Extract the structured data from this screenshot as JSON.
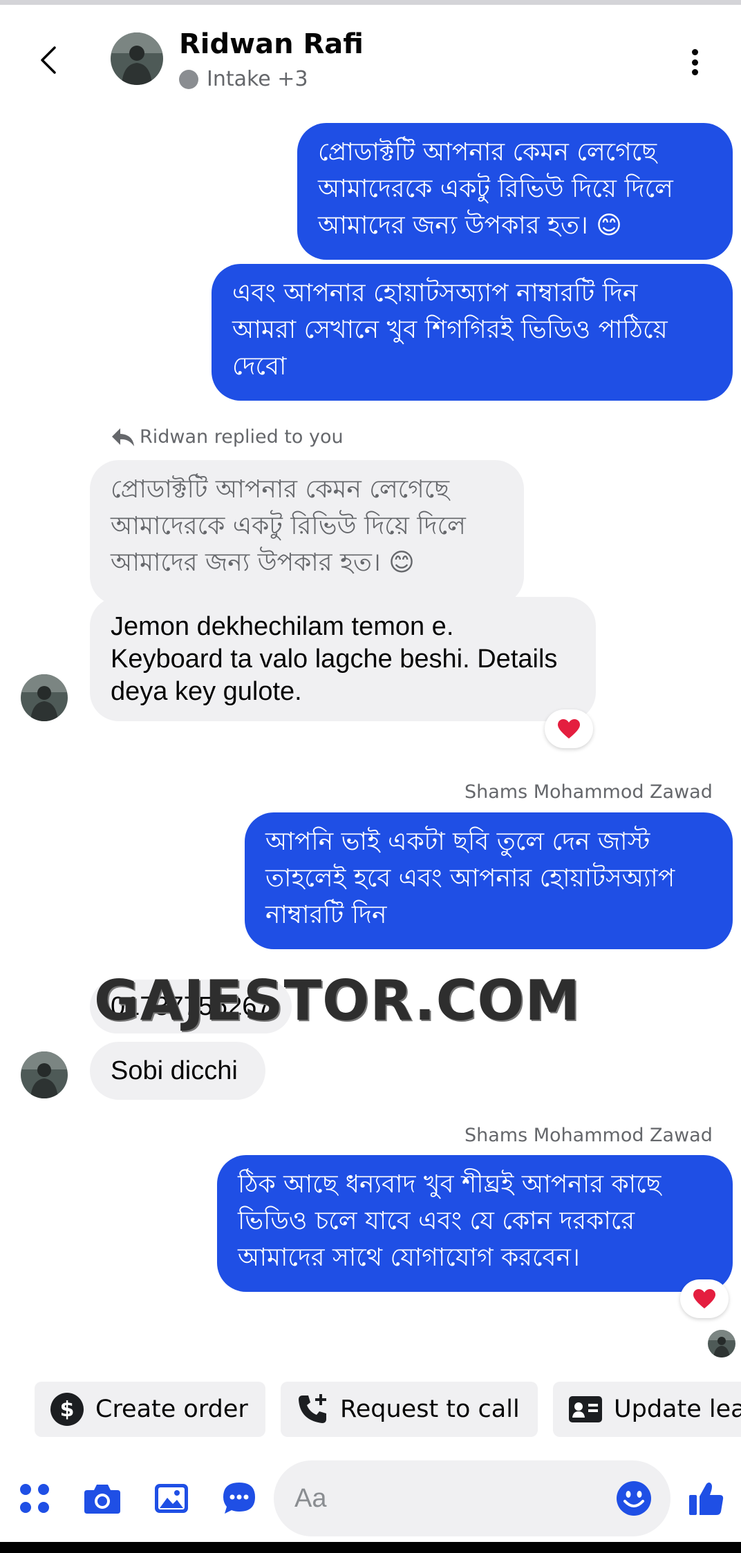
{
  "header": {
    "name": "Ridwan Rafi",
    "status": "Intake +3",
    "back_icon": "chevron-left-icon",
    "more_icon": "more-vertical-icon"
  },
  "messages": {
    "out1": "প্রোডাক্টটি আপনার কেমন লেগেছে\nআমাদেরকে একটু রিভিউ দিয়ে দিলে\nআমাদের জন্য উপকার হত। 😊",
    "out2": "এবং আপনার হোয়াটসঅ্যাপ নাম্বারটি দিন\nআমরা সেখানে খুব শিগগিরই ভিডিও পাঠিয়ে\nদেবো",
    "reply_label": "Ridwan replied to you",
    "quoted": "প্রোডাক্টটি আপনার কেমন লেগেছে\nআমাদেরকে একটু রিভিউ দিয়ে দিলে\nআমাদের জন্য উপকার হত। 😊",
    "in1": "Jemon dekhechilam temon e.\nKeyboard ta valo lagche beshi. Details\ndeya key gulote.",
    "sender1": "Shams Mohammod Zawad",
    "out3": "আপনি ভাই একটা ছবি তুলে দেন জাস্ট\nতাহলেই হবে এবং আপনার হোয়াটসঅ্যাপ\nনাম্বারটি দিন",
    "in2": "01737756267",
    "in3": "Sobi dicchi",
    "sender2": "Shams Mohammod Zawad",
    "out4": "ঠিক আছে ধন্যবাদ খুব শীঘ্রই আপনার কাছে\nভিডিও চলে যাবে এবং যে কোন দরকারে\nআমাদের সাথে যোগাযোগ করবেন।",
    "reaction": "❤️"
  },
  "watermark": "GAJESTOR.COM",
  "quick_actions": [
    {
      "label": "Create order",
      "icon": "dollar-icon"
    },
    {
      "label": "Request to call",
      "icon": "phone-plus-icon"
    },
    {
      "label": "Update lea",
      "icon": "contact-card-icon"
    }
  ],
  "composer": {
    "placeholder": "Aa",
    "icons": [
      "apps-icon",
      "camera-icon",
      "image-icon",
      "chat-bubble-icon",
      "emoji-icon",
      "thumbs-up-icon"
    ]
  },
  "colors": {
    "accent": "#1f4fe5",
    "incoming_bubble": "#f0f0f2",
    "reaction": "#e41e3f"
  }
}
